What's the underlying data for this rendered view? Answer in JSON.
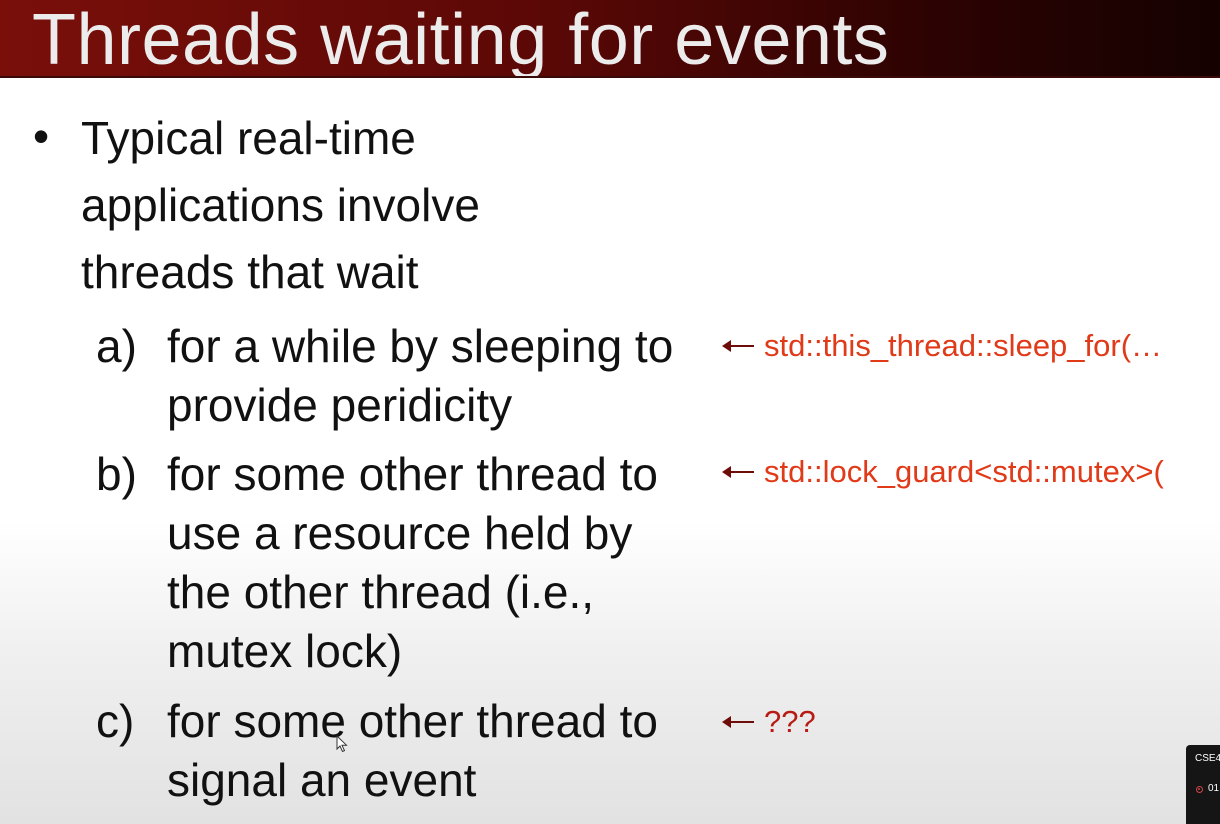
{
  "slide": {
    "title": "Threads waiting for events",
    "bullet": {
      "symbol": "•",
      "lines": [
        "Typical real-time",
        "applications involve",
        "threads that wait"
      ]
    },
    "items": [
      {
        "marker": "a)",
        "lines": [
          "for a while by sleeping to",
          "provide peridicity"
        ],
        "annotation": "std::this_thread::sleep_for(…"
      },
      {
        "marker": "b)",
        "lines": [
          "for some other thread to",
          "use a resource held by",
          "the other thread (i.e.,",
          "mutex lock)"
        ],
        "annotation": "std::lock_guard<std::mutex>("
      },
      {
        "marker": "c)",
        "lines": [
          "for some other thread to",
          "signal an event"
        ],
        "annotation": "???"
      }
    ],
    "annotation_arrow": "←"
  },
  "overlay": {
    "label": "CSE4",
    "time": "01"
  },
  "colors": {
    "title_bar": "#6a0a07",
    "title_text": "#ececec",
    "body_text": "#111111",
    "annotation_text": "#e03a18",
    "arrow": "#6e0d08"
  }
}
